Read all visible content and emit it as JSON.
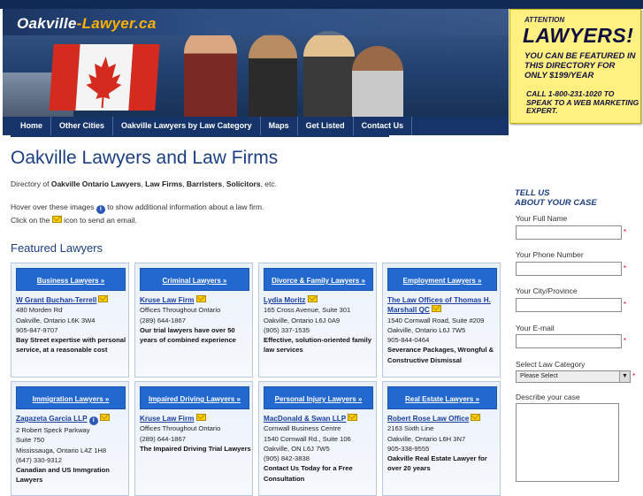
{
  "banner": {
    "logo_a": "Oakville",
    "logo_b": "-Lawyer.ca"
  },
  "ad": {
    "attention": "ATTENTION",
    "lawyers": "LAWYERS!",
    "body": "YOU CAN BE FEATURED IN THIS DIRECTORY FOR ONLY $199/YEAR",
    "call": "CALL 1-800-231-1020 TO SPEAK TO A WEB MARKETING EXPERT."
  },
  "nav": [
    "Home",
    "Other Cities",
    "Oakville Lawyers by Law Category",
    "Maps",
    "Get Listed",
    "Contact Us"
  ],
  "page": {
    "title": "Oakville Lawyers and Law Firms",
    "intro_pre": "Directory of ",
    "intro_b1": "Oakville Ontario Lawyers",
    "intro_sep1": ", ",
    "intro_b2": "Law Firms",
    "intro_sep2": ", ",
    "intro_b3": "Barristers",
    "intro_sep3": ", ",
    "intro_b4": "Solicitors",
    "intro_post": ", etc.",
    "hover_pre": "Hover over these images ",
    "hover_post": " to show additional information about a law firm.",
    "click_pre": "Click on the ",
    "click_post": " icon to send an email.",
    "featured": "Featured Lawyers"
  },
  "cards": [
    {
      "head": "Business Lawyers »",
      "name": "W Grant Buchan-Terrell",
      "lines": [
        "480 Morden Rd",
        "Oakville, Ontario L6K 3W4",
        "905-847-9707"
      ],
      "desc": "Bay Street expertise with personal service, at a reasonable cost"
    },
    {
      "head": "Criminal Lawyers »",
      "name": "Kruse Law Firm",
      "lines": [
        "Offices Throughout Ontario",
        "(289) 644-1867"
      ],
      "desc": "Our trial lawyers have over 50 years of combined experience"
    },
    {
      "head": "Divorce & Family Lawyers »",
      "name": "Lydia Moritz",
      "lines": [
        "165 Cross Avenue, Suite 301",
        "Oakville, Ontario L6J 0A9",
        "(905) 337-1535"
      ],
      "desc": "Effective, solution-oriented family law services"
    },
    {
      "head": "Employment Lawyers »",
      "name": "The Law Offices of Thomas H. Marshall QC",
      "lines": [
        "1540 Cornwall Road, Suite #209",
        "Oakville, Ontario L6J 7W5",
        "905-844-0464"
      ],
      "desc": "Severance Packages, Wrongful & Constructive Dismissal"
    },
    {
      "head": "Immigration Lawyers »",
      "name": "Zagazeta Garcia LLP",
      "lines": [
        "2 Robert Speck Parkway",
        "Suite 750",
        "Mississauga, Ontario L4Z 1H8",
        "(647) 330-9312"
      ],
      "desc": "Canadian and US Immgration Lawyers"
    },
    {
      "head": "Impaired Driving Lawyers »",
      "name": "Kruse Law Firm",
      "lines": [
        "Offices Throughout Ontario",
        "(289) 644-1867"
      ],
      "desc": "The Impaired Driving Trial Lawyers"
    },
    {
      "head": "Personal Injury Lawyers »",
      "name": "MacDonald & Swan LLP",
      "lines": [
        "Cornwall Business Centre",
        "1540 Cornwall Rd., Suite 106",
        "Oakville, ON L6J 7W5",
        "(905) 842-3838"
      ],
      "desc": "Contact Us Today for a Free Consultation"
    },
    {
      "head": "Real Estate Lawyers »",
      "name": "Robert Rose Law Office",
      "lines": [
        "2163 Sixth Line",
        "Oakville, Ontario L6H 3N7",
        "905-338-9555"
      ],
      "desc": "Oakville Real Estate Lawyer for over 20 years"
    }
  ],
  "form": {
    "tell": "TELL US",
    "about": "ABOUT YOUR CASE",
    "name": "Your Full Name",
    "phone": "Your Phone Number",
    "city": "Your City/Province",
    "email": "Your E-mail",
    "category": "Select Law Category",
    "category_value": "Please Select",
    "describe": "Describe your case",
    "req": "*"
  },
  "colors": {
    "nav": "#17346a",
    "accent": "#1c3f82",
    "card_head": "#2368cf",
    "ad": "#fff080"
  }
}
